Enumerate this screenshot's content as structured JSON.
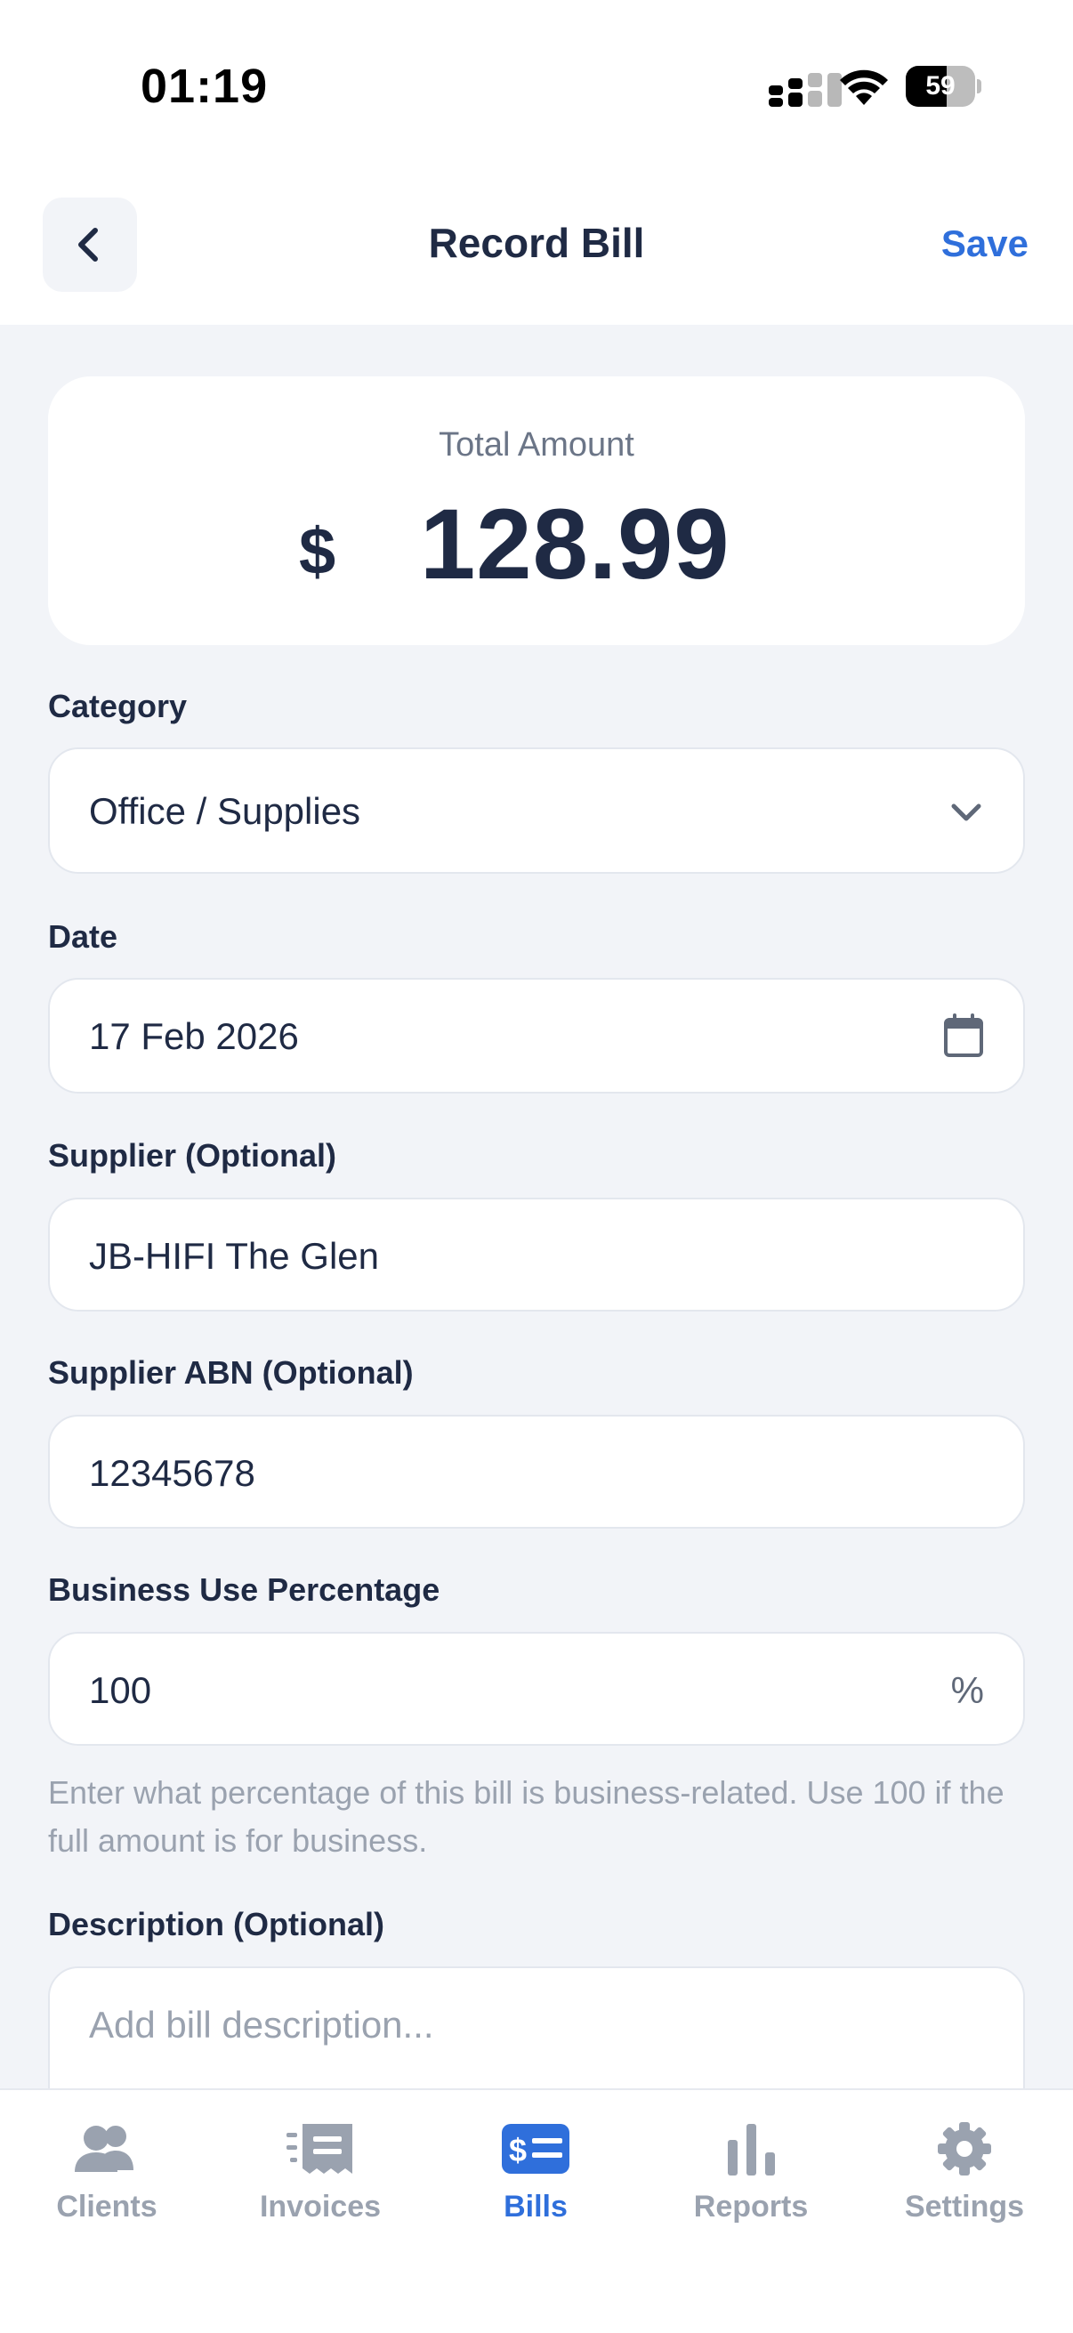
{
  "status_bar": {
    "time": "01:19",
    "battery": "59",
    "battery_level": 0.59
  },
  "header": {
    "title": "Record Bill",
    "save_label": "Save",
    "back_icon": "chevron-left-icon"
  },
  "total": {
    "label": "Total Amount",
    "currency": "$",
    "amount": "128.99"
  },
  "form": {
    "category": {
      "label": "Category",
      "value": "Office / Supplies",
      "icon": "chevron-down-icon"
    },
    "date": {
      "label": "Date",
      "value": "17 Feb 2026",
      "icon": "calendar-icon"
    },
    "supplier": {
      "label": "Supplier (Optional)",
      "value": "JB-HIFI The Glen"
    },
    "supplier_abn": {
      "label": "Supplier ABN (Optional)",
      "value": "12345678"
    },
    "business_use": {
      "label": "Business Use Percentage",
      "value": "100",
      "suffix": "%",
      "helper": "Enter what percentage of this bill is business-related. Use 100 if the full amount is for business."
    },
    "description": {
      "label": "Description (Optional)",
      "placeholder": "Add bill description..."
    }
  },
  "nav": {
    "active": "Bills",
    "items": [
      {
        "label": "Clients",
        "icon": "users-icon"
      },
      {
        "label": "Invoices",
        "icon": "receipt-icon"
      },
      {
        "label": "Bills",
        "icon": "bill-icon"
      },
      {
        "label": "Reports",
        "icon": "bar-chart-icon"
      },
      {
        "label": "Settings",
        "icon": "gear-icon"
      }
    ]
  },
  "colors": {
    "accent": "#2f6fdb",
    "text_primary": "#1f2a44",
    "text_muted": "#9aa2af",
    "background": "#f2f4f8"
  }
}
